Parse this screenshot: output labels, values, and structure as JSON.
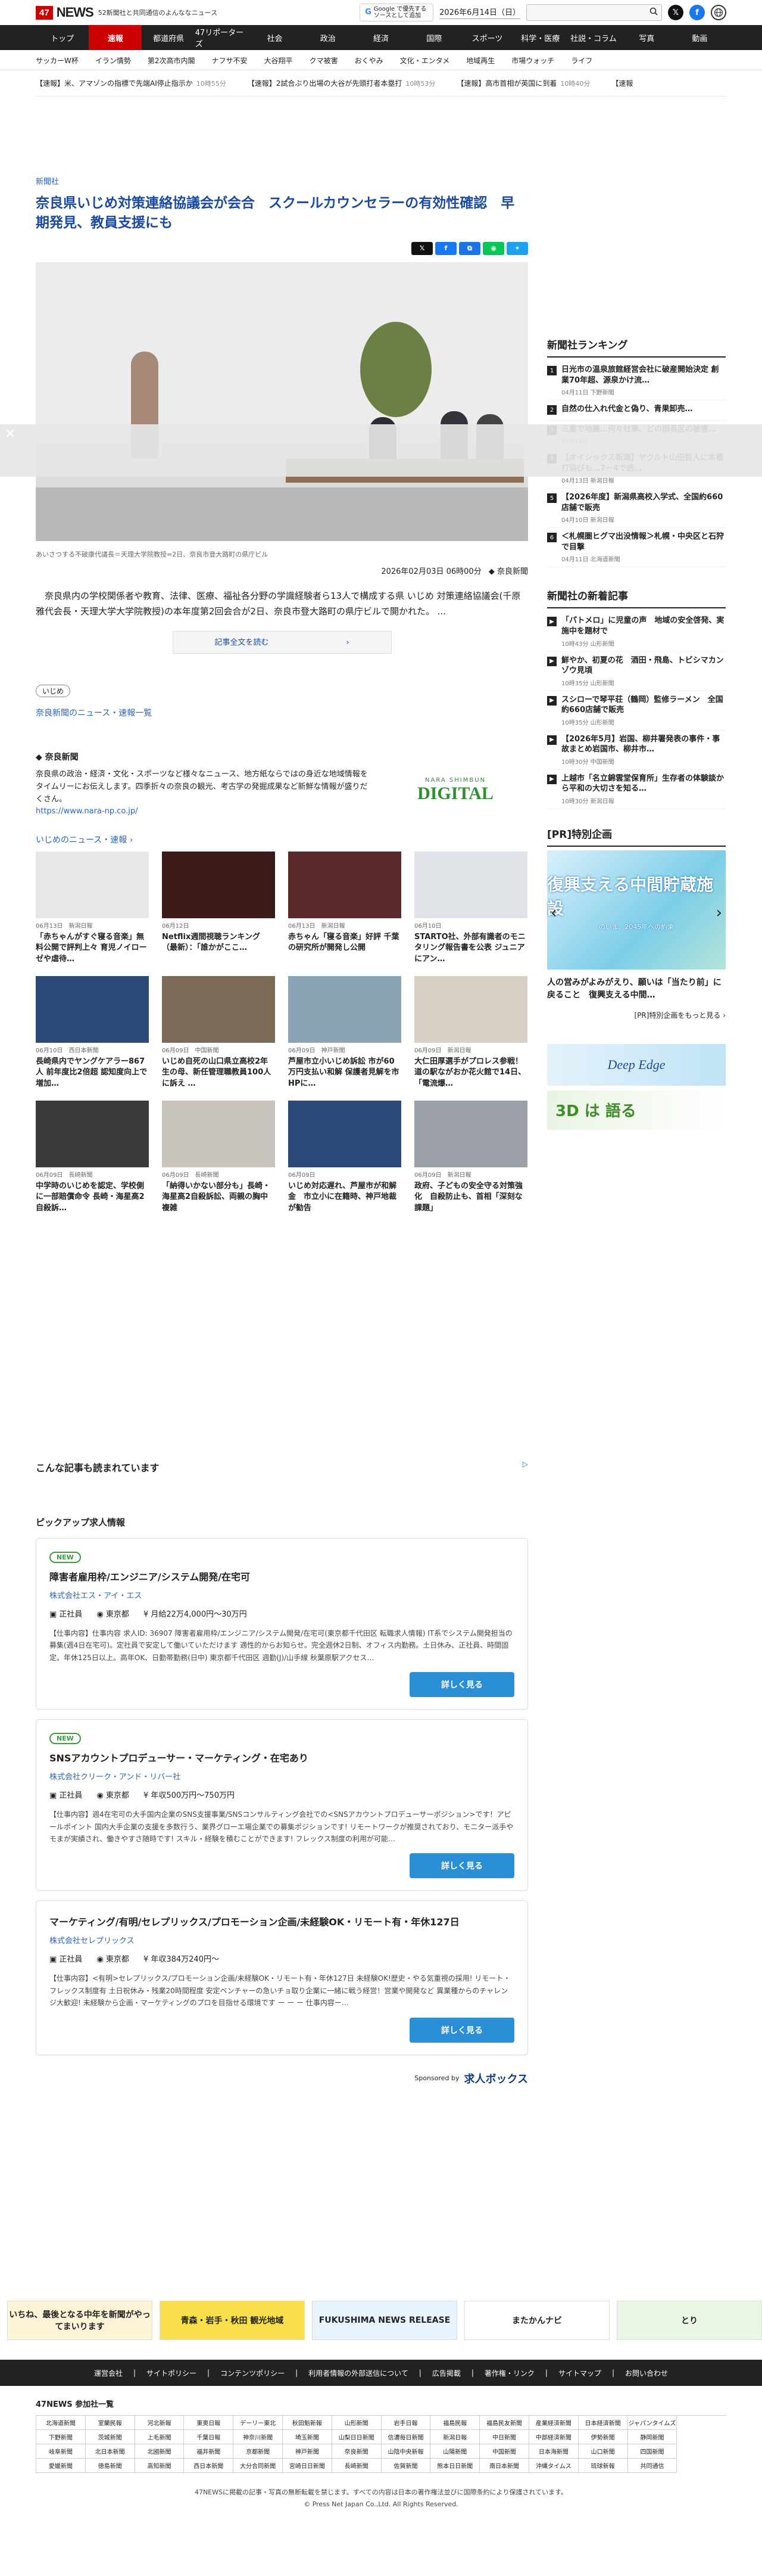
{
  "header": {
    "logo_mark": "47",
    "logo_text": "NEWS",
    "tagline": "52新聞社と共同通信のよんななニュース",
    "google_badge_line1": "Google で優先する",
    "google_badge_line2": "ソースとして追加",
    "date": "2026年6月14日（日）",
    "search_placeholder": ""
  },
  "main_nav": [
    "トップ",
    "速報",
    "都道府県",
    "47リポーターズ",
    "社会",
    "政治",
    "経済",
    "国際",
    "スポーツ",
    "科学・医療",
    "社説・コラム",
    "写真",
    "動画"
  ],
  "sub_nav": [
    "サッカーW杯",
    "イラン情勢",
    "第2次高市内閣",
    "ナフサ不安",
    "大谷翔平",
    "クマ被害",
    "おくやみ",
    "文化・エンタメ",
    "地域再生",
    "市場ウォッチ",
    "ライフ"
  ],
  "ticker": [
    {
      "text": "【速報】米、アマゾンの指標で先端AI停止指示か",
      "time": "10時55分"
    },
    {
      "text": "【速報】2試合ぶり出場の大谷が先頭打者本塁打",
      "time": "10時53分"
    },
    {
      "text": "【速報】高市首相が英国に到着",
      "time": "10時40分"
    },
    {
      "text": "【速報",
      "time": ""
    }
  ],
  "article": {
    "category": "新聞社",
    "title": "奈良県いじめ対策連絡協議会が会合　スクールカウンセラーの有効性確認　早期発見、教員支援にも",
    "caption": "あいさつする不破康代議長＝天理大学院教授=2日、奈良市登大路町の県庁ビル",
    "pub_date": "2026年02月03日 06時00分",
    "source": "奈良新聞",
    "lead": "奈良県内の学校関係者や教育、法律、医療、福祉各分野の学識経験者ら13人で構成する県 いじめ 対策連絡協議会(千原雅代会長・天理大学大学院教授)の本年度第2回会合が2日、奈良市登大路町の県庁ビルで開かれた。 ...",
    "readmore": "記事全文を読む　　　　　　　　　　›",
    "tag": "いじめ",
    "newslist_link": "奈良新聞のニュース・速報一覧"
  },
  "provider": {
    "name": "奈良新聞",
    "desc": "奈良県の政治・経済・文化・スポーツなど様々なニュース、地方紙ならではの身近な地域情報をタイムリーにお伝えします。四季折々の奈良の観光、考古学の発掘成果など新鮮な情報が盛りだくさん。",
    "url": "https://www.nara-np.co.jp/",
    "banner_top": "NARA SHIMBUN",
    "banner_main": "DIGITAL"
  },
  "ijime": {
    "heading": "いじめのニュース・速報 ›",
    "cards": [
      {
        "date": "06月13日",
        "src": "新潟日報",
        "title": "「赤ちゃんがすぐ寝る音楽」無料公開で評判上々 育児ノイローゼや虐待…"
      },
      {
        "date": "06月12日",
        "src": "",
        "title": "Netflix週間視聴ランキング（最新）：「誰かがここ…"
      },
      {
        "date": "06月13日",
        "src": "新潟日報",
        "title": "赤ちゃん「寝る音楽」好評 千葉の研究所が開発し公開"
      },
      {
        "date": "06月10日",
        "src": "",
        "title": "STARTO社、外部有識者のモニタリング報告書を公表 ジュニアにアン…"
      },
      {
        "date": "06月10日",
        "src": "西日本新聞",
        "title": "長崎県内でヤングケアラー867人 前年度比2倍超 認知度向上で増加…"
      },
      {
        "date": "06月09日",
        "src": "中国新聞",
        "title": "いじめ自死の山口県立高校2年生の母、新任管理職教員100人に訴え …"
      },
      {
        "date": "06月09日",
        "src": "神戸新聞",
        "title": "芦屋市立小いじめ訴訟 市が60万円支払い和解 保護者見解を市HPに…"
      },
      {
        "date": "06月09日",
        "src": "新潟日報",
        "title": "大仁田厚選手がプロレス参戦！道の駅ながおか花火館で14日、「電流爆…"
      },
      {
        "date": "06月09日",
        "src": "長崎新聞",
        "title": "中学時のいじめを認定、学校側に一部賠償命令 長崎・海星高2自殺訴…"
      },
      {
        "date": "06月09日",
        "src": "長崎新聞",
        "title": "「納得いかない部分も」長崎・海星高2自殺訴訟、両親の胸中複雑"
      },
      {
        "date": "06月09日",
        "src": "",
        "title": "いじめ対応遅れ、芦屋市が和解金　市立小に在籍時、神戸地裁が勧告"
      },
      {
        "date": "06月09日",
        "src": "新潟日報",
        "title": "政府、子どもの安全守る対策強化　自殺防止も、首相「深刻な課題」"
      }
    ]
  },
  "ranking": {
    "heading": "新聞社ランキング",
    "items": [
      {
        "title": "日光市の温泉旅館経営会社に破産開始決定 創業70年超、源泉かけ流…",
        "src": "下野新聞",
        "date": "04月11日"
      },
      {
        "title": "自然の仕入れ代金と偽り、青果卸売…",
        "src": "",
        "date": ""
      },
      {
        "title": "三重で地震…何々社事、どの国長区の被害…",
        "src": "",
        "date": "04月10日"
      },
      {
        "title": "【オイシックス新潟】ヤクルト山田哲人に本塁打浴びも…7－4で逃…",
        "src": "新潟日報",
        "date": "04月13日"
      },
      {
        "title": "【2026年度】新潟県高校入学式、全国約660店舗で販売",
        "src": "新潟日報",
        "date": "04月10日"
      },
      {
        "title": "＜札幌圏ヒグマ出没情報＞札幌・中央区と石狩で目撃",
        "src": "北海道新聞",
        "date": "04月11日"
      }
    ]
  },
  "newest": {
    "heading": "新聞社の新着記事",
    "items": [
      {
        "title": "「パトメロ」に児童の声　地域の安全啓発、実施中を題材で",
        "src": "山形新聞",
        "date": "10時43分"
      },
      {
        "title": "鮮やか、初夏の花　酒田・飛島、トビシマカンゾウ見頃",
        "src": "山形新聞",
        "date": "10時35分"
      },
      {
        "title": "スシローで琴平荘（鶴岡）監修ラーメン　全国約660店舗で販売",
        "src": "山形新聞",
        "date": "10時35分"
      },
      {
        "title": "【2026年5月】岩国、柳井署発表の事件・事故まとめ岩国市、柳井市…",
        "src": "中国新聞",
        "date": "10時30分"
      },
      {
        "title": "上越市「名立錦雲堂保育所」生存者の体験談から平和の大切さを知る…",
        "src": "新潟日報",
        "date": "10時30分"
      }
    ]
  },
  "pr": {
    "heading": "[PR]特別企画",
    "img_title": "復興支える中間貯蔵施設",
    "img_sub": "のいま、2045年への約束",
    "caption": "人の営みがよみがえり、願いは「当たり前」に戻ること　復興支える中間…",
    "more": "[PR]特別企画をもっと見る ›",
    "ad1": "Deep Edge",
    "ad2": "3D は 語る"
  },
  "jobs": {
    "recommend": "こんな記事も読まれています",
    "heading": "ピックアップ求人情報",
    "list": [
      {
        "is_new": true,
        "badge": "NEW",
        "title": "障害者雇用枠/エンジニア/システム開発/在宅可",
        "company": "株式会社エス・アイ・エス",
        "type": "正社員",
        "place": "東京都",
        "salary": "月給22万4,000円〜30万円",
        "desc": "【仕事内容】仕事内容 求人ID: 36907 障害者雇用枠/エンジニア/システム開発/在宅可(東京都千代田区 転職求人情報) IT系でシステム開発担当の募集(週4日在宅可)。定社員で安定して働いていただけます 適性的からお知らせ。完全週休2日制、オフィス内勤務。土日休み、正社員、時間固定。年休125日以上。高年OK、日勤帯勤務(日中) 東京都千代田区 週勤(J)/山手線 秋葉原駅アクセス…",
        "button": "詳しく見る"
      },
      {
        "is_new": true,
        "badge": "NEW",
        "title": "SNSアカウントプロデューサー・マーケティング・在宅あり",
        "company": "株式会社クリーク・アンド・リバー社",
        "type": "正社員",
        "place": "東京都",
        "salary": "年収500万円〜750万円",
        "desc": "【仕事内容】週4在宅可の大手国内企業のSNS支援事業/SNSコンサルティング会社での<SNSアカウントプロデューサーポジション>です！アピールポイント 国内大手企業の支援を多数行う、業界グローエ場企業での募集ポジションです! リモートワークが推奨されており、モニター派手やモまが実績され、働きやすさ随時です! スキル・経験を積むことができます! フレックス制度の利用が可能…",
        "button": "詳しく見る"
      },
      {
        "is_new": false,
        "badge": "",
        "title": "マーケティング/有明/セレプリックス/プロモーション企画/未経験OK・リモート有・年休127日",
        "company": "株式会社セレプリックス",
        "type": "正社員",
        "place": "東京都",
        "salary": "年収384万240円〜",
        "desc": "【仕事内容】<有明>セレプリックス/プロモーション企画/未経験OK・リモート有・年休127日 未経験OK!歴史・やる気重視の採用! リモート・フレックス制度有 土日祝休み・残業20時間程度 安定ベンチャーの急いチョ取り企業に一緒に戦う経営！営業や開発など 異業種からのチャレンジ大歓迎! 未経験から企画・マーケティングのプロを目指せる環境です ー ー ー 仕事内容ー…",
        "button": "詳しく見る"
      }
    ],
    "sponsor_label": "Sponsored by",
    "sponsor_name": "求人ボックス"
  },
  "banners": [
    {
      "text": "いちね、最後となる中年を新聞がやってまいります"
    },
    {
      "text": "青森・岩手・秋田 観光地域"
    },
    {
      "text": "FUKUSHIMA NEWS RELEASE"
    },
    {
      "text": "またかんナビ"
    },
    {
      "text": "とり"
    }
  ],
  "footer": {
    "nav": [
      "運営会社",
      "サイトポリシー",
      "コンテンツポリシー",
      "利用者情報の外部送信について",
      "広告掲載",
      "著作権・リンク",
      "サイトマップ",
      "お問い合わせ"
    ],
    "members_heading": "47NEWS 参加社一覧",
    "members": [
      "北海道新聞",
      "室蘭民報",
      "河北新報",
      "東奥日報",
      "デーリー東北",
      "秋田魁新報",
      "山形新聞",
      "岩手日報",
      "福島民報",
      "福島民友新聞",
      "産業経済新聞",
      "日本経済新聞",
      "ジャパンタイムズ",
      "下野新聞",
      "茨城新聞",
      "上毛新聞",
      "千葉日報",
      "神奈川新聞",
      "埼玉新聞",
      "山梨日日新聞",
      "信濃毎日新聞",
      "新潟日報",
      "中日新聞",
      "中部経済新聞",
      "伊勢新聞",
      "静岡新聞",
      "岐阜新聞",
      "北日本新聞",
      "北國新聞",
      "福井新聞",
      "京都新聞",
      "神戸新聞",
      "奈良新聞",
      "山陰中央新報",
      "山陽新聞",
      "中国新聞",
      "日本海新聞",
      "山口新聞",
      "四国新聞",
      "愛媛新聞",
      "徳島新聞",
      "高知新聞",
      "西日本新聞",
      "大分合同新聞",
      "宮崎日日新聞",
      "長崎新聞",
      "佐賀新聞",
      "熊本日日新聞",
      "南日本新聞",
      "沖縄タイムス",
      "琉球新報",
      "共同通信"
    ],
    "copy1": "47NEWSに掲載の記事・写真の無断転載を禁じます。すべての内容は日本の著作権法並びに国際条約により保護されています。",
    "copy2": "© Press Net Japan Co.,Ltd. All Rights Reserved."
  },
  "colors": {
    "accent_red": "#cc0000",
    "link_blue": "#1a4aa0",
    "nav_dark": "#222222",
    "button_blue": "#2b8fd6",
    "new_green": "#3f9b3f"
  }
}
